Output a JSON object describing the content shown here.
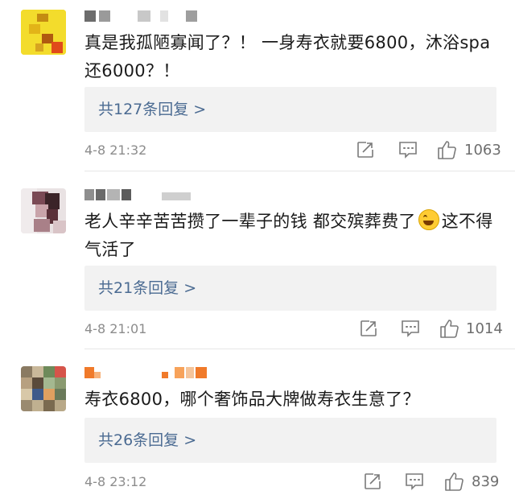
{
  "comments": [
    {
      "text": "真是我孤陋寡闻了？！ 一身寿衣就要6800，沐浴spa还6000？！",
      "reply_label": "共127条回复 >",
      "time": "4-8 21:32",
      "likes": "1063"
    },
    {
      "text_before": "老人辛辛苦苦攒了一辈子的钱 都交殡葬费了",
      "text_after": "这不得气活了",
      "emoji_icon": "laughing-crying-emoji",
      "reply_label": "共21条回复 >",
      "time": "4-8 21:01",
      "likes": "1014"
    },
    {
      "text": "寿衣6800，哪个奢饰品大牌做寿衣生意了？",
      "reply_label": "共26条回复 >",
      "time": "4-8 23:12",
      "likes": "839"
    }
  ],
  "icons": {
    "share": "share-icon",
    "comment": "comment-icon",
    "like": "thumbs-up-icon"
  },
  "colors": {
    "reply_link": "#4b6b92",
    "reply_bg": "#f2f2f2",
    "meta_text": "#8c8c8c"
  }
}
